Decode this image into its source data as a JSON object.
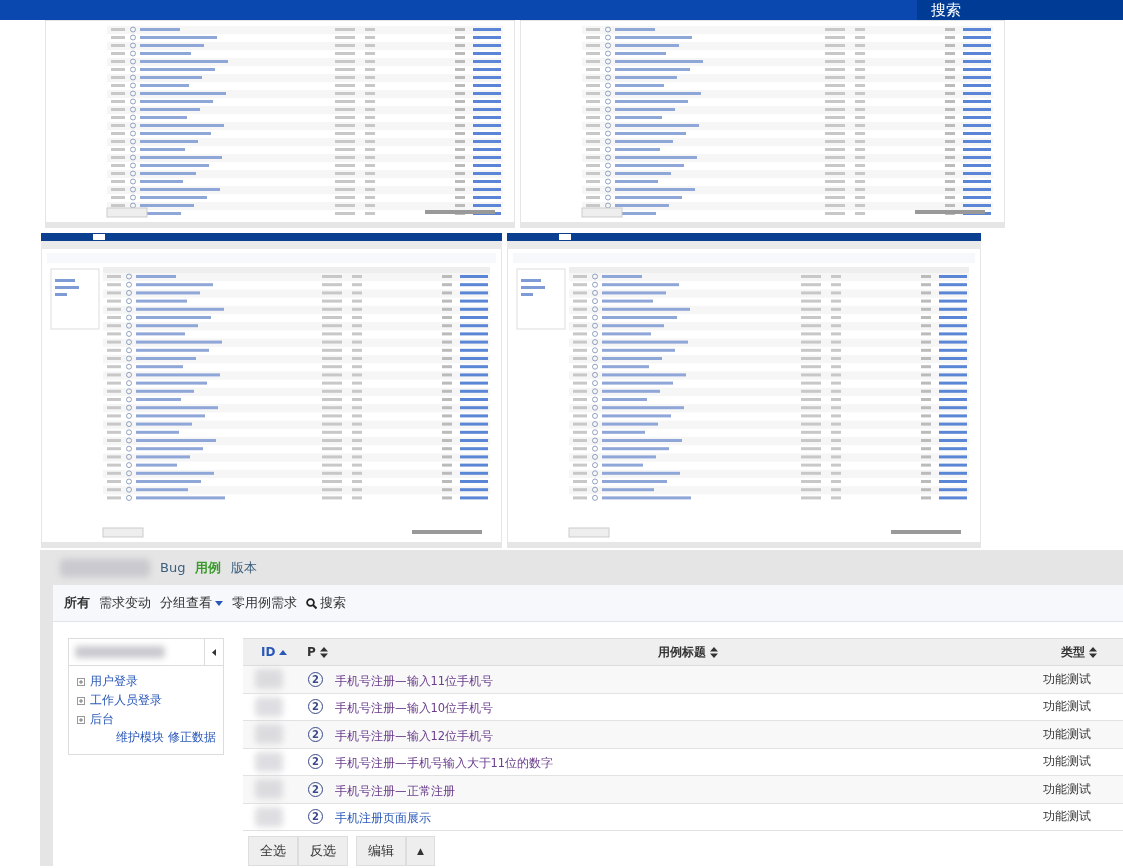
{
  "top_bar": {
    "search_button": "搜索"
  },
  "thumbnails": [
    {
      "kind": "list"
    },
    {
      "kind": "list"
    },
    {
      "kind": "tree_list"
    },
    {
      "kind": "tree_list"
    }
  ],
  "product_nav": [
    {
      "label": "Bug",
      "selected": false
    },
    {
      "label": "用例",
      "selected": true
    },
    {
      "label": "版本",
      "selected": false
    }
  ],
  "filters": [
    {
      "label": "所有",
      "kind": "link",
      "selected": true
    },
    {
      "label": "需求变动",
      "kind": "link",
      "selected": false
    },
    {
      "label": "分组查看",
      "kind": "dropdown",
      "selected": false
    },
    {
      "label": "零用例需求",
      "kind": "link",
      "selected": false
    },
    {
      "label": "搜索",
      "kind": "search",
      "selected": false
    }
  ],
  "module_tree": {
    "items": [
      {
        "label": "用户登录",
        "expanded": false
      },
      {
        "label": "工作人员登录",
        "expanded": false
      },
      {
        "label": "后台",
        "expanded": false
      }
    ],
    "actions": [
      "维护模块",
      "修正数据"
    ]
  },
  "table": {
    "columns": [
      {
        "label": "ID",
        "sorted": true
      },
      {
        "label": "P",
        "sorted": false
      },
      {
        "label": "用例标题",
        "sorted": false
      },
      {
        "label": "类型",
        "sorted": false
      }
    ],
    "rows": [
      {
        "priority": "2",
        "title": "手机号注册—输入11位手机号",
        "visited": true,
        "type": "功能测试"
      },
      {
        "priority": "2",
        "title": "手机号注册—输入10位手机号",
        "visited": true,
        "type": "功能测试"
      },
      {
        "priority": "2",
        "title": "手机号注册—输入12位手机号",
        "visited": true,
        "type": "功能测试"
      },
      {
        "priority": "2",
        "title": "手机号注册—手机号输入大于11位的数字",
        "visited": true,
        "type": "功能测试"
      },
      {
        "priority": "2",
        "title": "手机号注册—正常注册",
        "visited": true,
        "type": "功能测试"
      },
      {
        "priority": "2",
        "title": "手机注册页面展示",
        "visited": false,
        "type": "功能测试"
      }
    ]
  },
  "footer_buttons": [
    {
      "label": "全选",
      "kind": "plain"
    },
    {
      "label": "反选",
      "kind": "plain"
    },
    {
      "label": "编辑",
      "kind": "plain"
    },
    {
      "label": "▲",
      "kind": "caret"
    }
  ]
}
